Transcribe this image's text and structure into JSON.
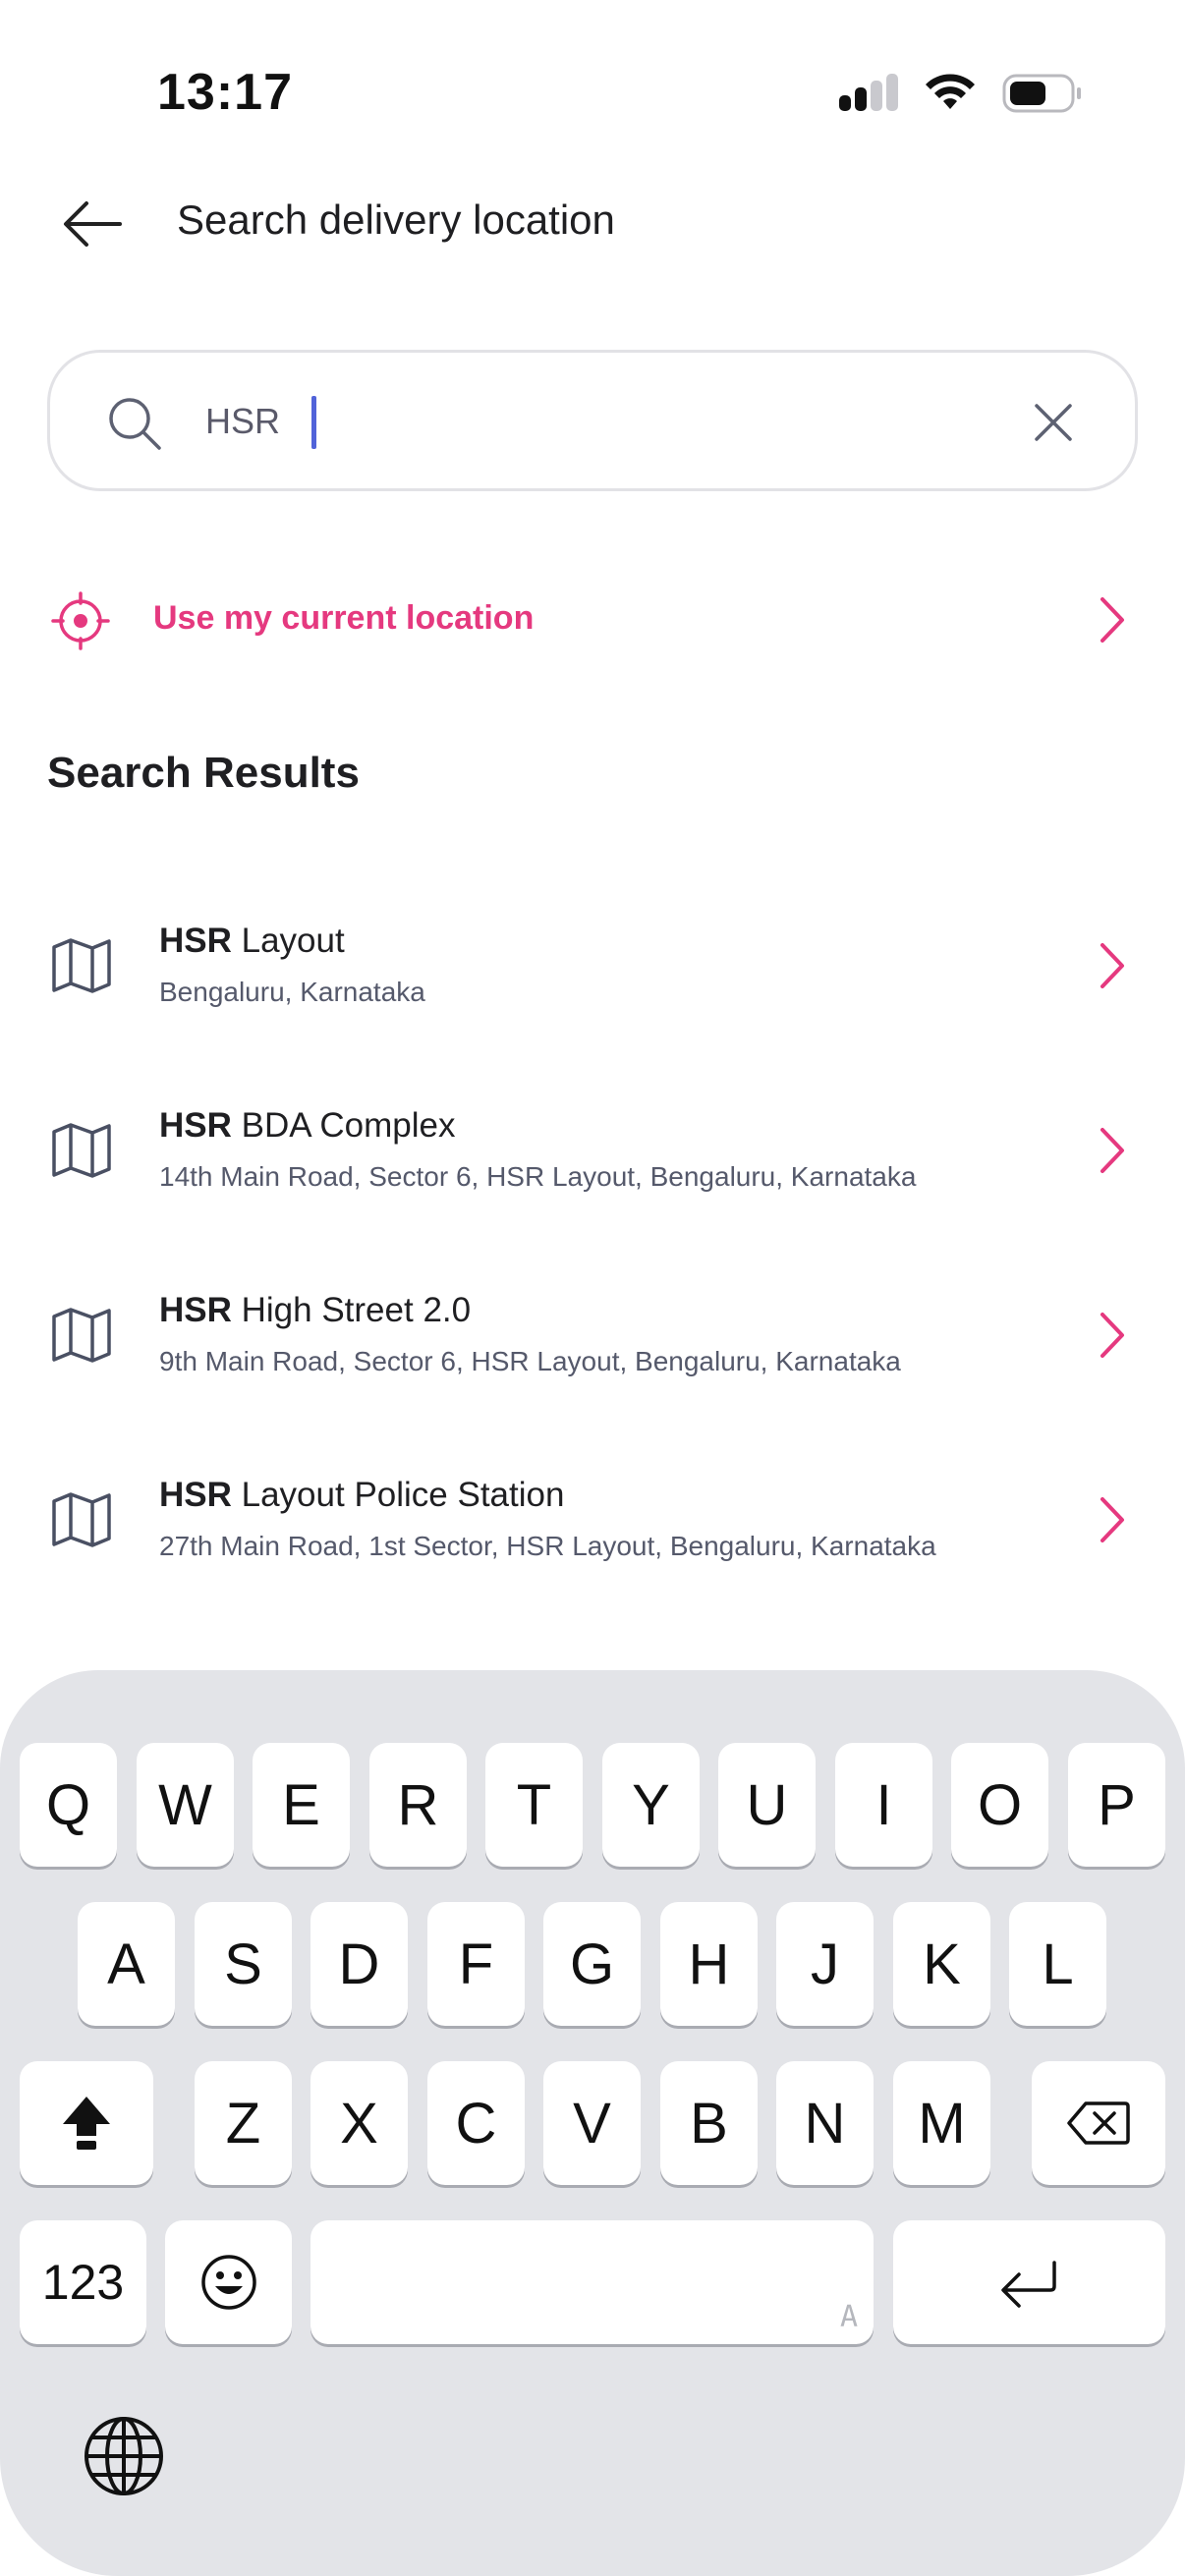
{
  "status_bar": {
    "time": "13:17"
  },
  "header": {
    "title": "Search delivery location"
  },
  "search": {
    "value": "HSR",
    "placeholder": ""
  },
  "current_location": {
    "label": "Use my current location"
  },
  "results_heading": "Search Results",
  "results": [
    {
      "match": "HSR",
      "rest": " Layout",
      "subtitle": "Bengaluru, Karnataka"
    },
    {
      "match": "HSR",
      "rest": " BDA Complex",
      "subtitle": "14th Main Road, Sector 6, HSR Layout, Bengaluru, Karnataka"
    },
    {
      "match": "HSR",
      "rest": " High Street 2.0",
      "subtitle": "9th Main Road, Sector 6, HSR Layout, Bengaluru, Karnataka"
    },
    {
      "match": "HSR",
      "rest": " Layout Police Station",
      "subtitle": "27th Main Road, 1st Sector, HSR Layout, Bengaluru, Karnataka"
    }
  ],
  "keyboard": {
    "row1": [
      "Q",
      "W",
      "E",
      "R",
      "T",
      "Y",
      "U",
      "I",
      "O",
      "P"
    ],
    "row2": [
      "A",
      "S",
      "D",
      "F",
      "G",
      "H",
      "J",
      "K",
      "L"
    ],
    "row3": [
      "Z",
      "X",
      "C",
      "V",
      "B",
      "N",
      "M"
    ],
    "numbers_key": "123",
    "space_hint": "A"
  },
  "colors": {
    "accent": "#e5397f",
    "caret": "#5163d9",
    "keyboard_bg": "#e3e4e8"
  },
  "icons": {
    "back": "arrow-left-icon",
    "search": "search-icon",
    "clear": "close-icon",
    "locate": "crosshair-icon",
    "result": "map-icon",
    "chevron": "chevron-right-icon",
    "shift": "shift-icon",
    "backspace": "backspace-icon",
    "emoji": "emoji-icon",
    "return": "return-icon",
    "globe": "globe-icon"
  }
}
